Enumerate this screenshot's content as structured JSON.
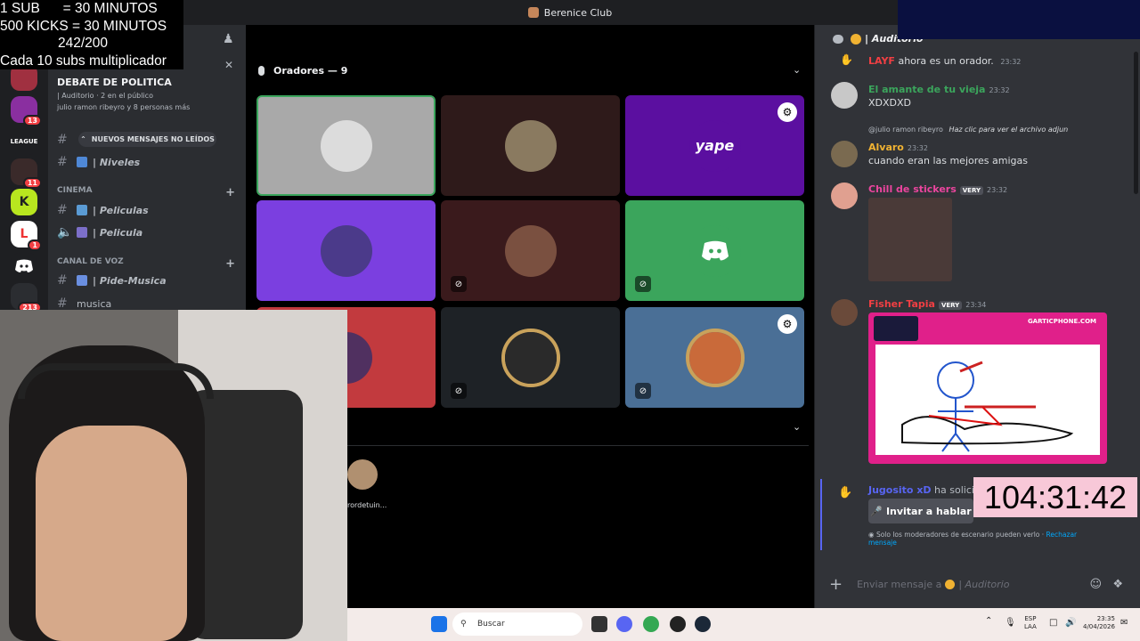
{
  "window": {
    "title": "Berenice Club"
  },
  "overlay": {
    "lines": [
      "1 SUB      = 30 MINUTOS",
      "500 KICKS = 30 MINUTOS",
      "242/200",
      "Cada 10 subs multiplicador"
    ]
  },
  "servers": {
    "badges": [
      "13",
      "11",
      "1",
      "213"
    ]
  },
  "sidebar": {
    "channel_title": "DEBATE DE POLITICA",
    "channel_info": "| Auditorio · 2 en el público",
    "channel_people": "julio ramon ribeyro y 8 personas más",
    "unread_label": "NUEVOS MENSAJES NO LEÍDOS",
    "items": [
      {
        "label": "| Niveles",
        "emoji_color": "#4f88d6"
      },
      {
        "label": "| Peliculas",
        "emoji_color": "#5a9bd4"
      },
      {
        "label": "| Pelicula",
        "emoji_color": "#7c6fc9"
      },
      {
        "label": "| Pide-Musica",
        "emoji_color": "#6a8fe0"
      },
      {
        "label": "musica"
      }
    ],
    "categories": [
      "CINEMA",
      "CANAL DE VOZ"
    ]
  },
  "stage": {
    "speakers_header": "Oradores — 9",
    "audience_name": "rordetuin...",
    "tiles": [
      {
        "bg": "#a9a9a9",
        "border": "#3ba55c",
        "avatar": "#444"
      },
      {
        "bg": "#2e1a1a",
        "avatar": "#8a7a60"
      },
      {
        "bg": "#5b0fa0",
        "avatar": "#5b0fa0",
        "label": "yape"
      },
      {
        "bg": "#7b3fe0",
        "avatar": "#4b3a8a"
      },
      {
        "bg": "#3a1a1c",
        "avatar": "#7a5040"
      },
      {
        "bg": "#3ba55c",
        "avatar": "#3ba55c"
      },
      {
        "bg": "#c23a3e",
        "avatar": "#503060"
      },
      {
        "bg": "#1e2226",
        "avatar": "#2a2a2a"
      },
      {
        "bg": "#4a6f96",
        "avatar": "#c96a3a"
      }
    ]
  },
  "chat": {
    "header": "| Auditorio",
    "messages": [
      {
        "user": "LAYF",
        "user_color": "#f23f43",
        "text": "ahora es un orador.",
        "time": "23:32"
      },
      {
        "user": "El amante de tu vieja",
        "user_color": "#3ba55c",
        "time": "23:32",
        "text": "XDXDXD"
      },
      {
        "reply": "@julio ramon ribeyro",
        "reply_text": "Haz clic para ver el archivo adjun"
      },
      {
        "user": "Alvaro",
        "user_color": "#f0b232",
        "time": "23:32",
        "text": "cuando eran las mejores amigas"
      },
      {
        "user": "Chill de stickers",
        "user_color": "#eb459e",
        "tag": "VERY",
        "time": "23:32"
      },
      {
        "user": "Fisher Tapia",
        "user_color": "#f23f43",
        "tag": "VERY",
        "time": "23:34"
      },
      {
        "user": "Jugosito xD",
        "user_color": "#5865f2",
        "text": "ha solicitad"
      }
    ],
    "image_label": "GARTICPHONE.COM",
    "invite_button": "Invitar a hablar",
    "mod_note": "Solo los moderadores de escenario pueden verlo · ",
    "mod_link": "Rechazar mensaje",
    "input_placeholder": "Enviar mensaje a",
    "input_channel": "| Auditorio"
  },
  "timer": "104:31:42",
  "taskbar": {
    "search_placeholder": "Buscar",
    "lang_top": "ESP",
    "lang_bottom": "LAA",
    "time": "23:35",
    "date": "4/04/2026"
  }
}
